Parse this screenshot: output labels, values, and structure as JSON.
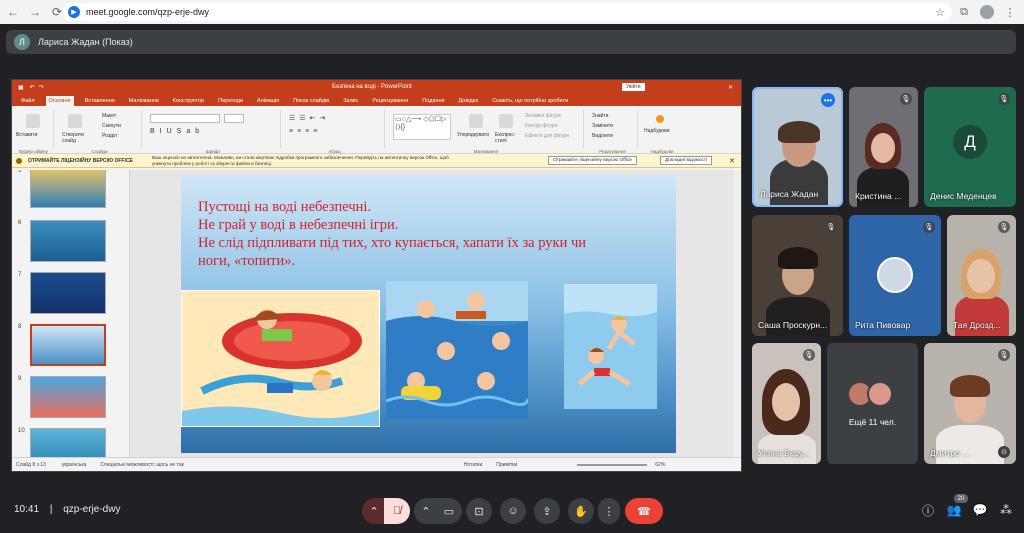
{
  "browser": {
    "url": "meet.google.com/qzp-erje-dwy",
    "back_icon": "arrow-left-icon",
    "forward_icon": "arrow-right-icon",
    "reload_icon": "reload-icon"
  },
  "presenter": {
    "initial": "Л",
    "label": "Лариса Жадан (Показ)"
  },
  "powerpoint": {
    "title": "Безпека на воді - PowerPoint",
    "signin": "Увійти",
    "tabs": [
      "Файл",
      "Основне",
      "Вставлення",
      "Малювання",
      "Конструктор",
      "Переходи",
      "Анімація",
      "Показ слайдів",
      "Запис",
      "Рецензування",
      "Подання",
      "Довідка",
      "Скажіть, що потрібно зробити"
    ],
    "active_tab_index": 1,
    "ribbon": {
      "paste": "Вставити",
      "new_slide": "Створити слайд",
      "layout": "Макет",
      "reset": "Скинути",
      "section": "Розділ",
      "arrange": "Упорядкувати",
      "quick_styles": "Експрес-стилі",
      "shape_fill": "Заливка фігури",
      "shape_outline": "Контур фігури",
      "shape_effects": "Ефекти для фігури",
      "find": "Знайти",
      "replace": "Замінити",
      "select": "Виділити",
      "designer": "Надбудови",
      "groups": [
        "Буфер обміну",
        "Слайди",
        "Шрифт",
        "Абзац",
        "Малювання",
        "Редагування",
        "Надбудови"
      ]
    },
    "warning": {
      "title": "ОТРИМАЙТЕ ЛІЦЕНЗІЙНУ ВЕРСІЮ OFFICE",
      "line1": "Ваш ліцензія не автентична. Можливо, ви стали жертвою підробки програмного забезпечення. Перейдіть на автентичну версію Office, щоб",
      "line2": "уникнути проблем у роботі та зберегти файли в безпеці.",
      "button1": "Отримайте ліцензійну версію Office",
      "button2": "Докладні відомості"
    },
    "thumbnails": [
      {
        "num": "5",
        "selected": false
      },
      {
        "num": "6",
        "selected": false
      },
      {
        "num": "7",
        "selected": false
      },
      {
        "num": "8",
        "selected": true
      },
      {
        "num": "9",
        "selected": false
      },
      {
        "num": "10",
        "selected": false
      }
    ],
    "slide": {
      "line1": "Пустощі на воді небезпечні.",
      "line2": "Не грай у воді в небезпечні ігри.",
      "line3": "Не слід підпливати під тих, хто купається, хапати їх за руки чи",
      "line4": "ноги, «топити»."
    },
    "status": {
      "slide": "Слайд 8 з 13",
      "language": "українська",
      "accessibility": "Спеціальні можливості: щось не так",
      "notes": "Нотатки",
      "comments": "Примітки",
      "zoom": "62%"
    }
  },
  "participants": [
    {
      "name": "Лариса Жадан",
      "muted": false
    },
    {
      "name": "Кристина ...",
      "muted": true
    },
    {
      "name": "Денис Меденцев",
      "muted": true,
      "initial": "Д"
    },
    {
      "name": "Саша Проскурн...",
      "muted": true
    },
    {
      "name": "Рита Пивовар",
      "muted": true
    },
    {
      "name": "Тая Дрозд...",
      "muted": true
    },
    {
      "name": "Уляна Бєру...",
      "muted": true
    },
    {
      "name": "Ещё 11 чел.",
      "muted": false
    },
    {
      "name": "Дмитро ...",
      "muted": true
    }
  ],
  "bottom": {
    "time": "10:41",
    "separator": "|",
    "meeting_code": "qzp-erje-dwy",
    "participant_count": "20"
  },
  "colors": {
    "ppt_red": "#c43e1c",
    "meet_bg": "#202124",
    "hangup_red": "#ea4335",
    "slide_text": "#d3202a"
  }
}
